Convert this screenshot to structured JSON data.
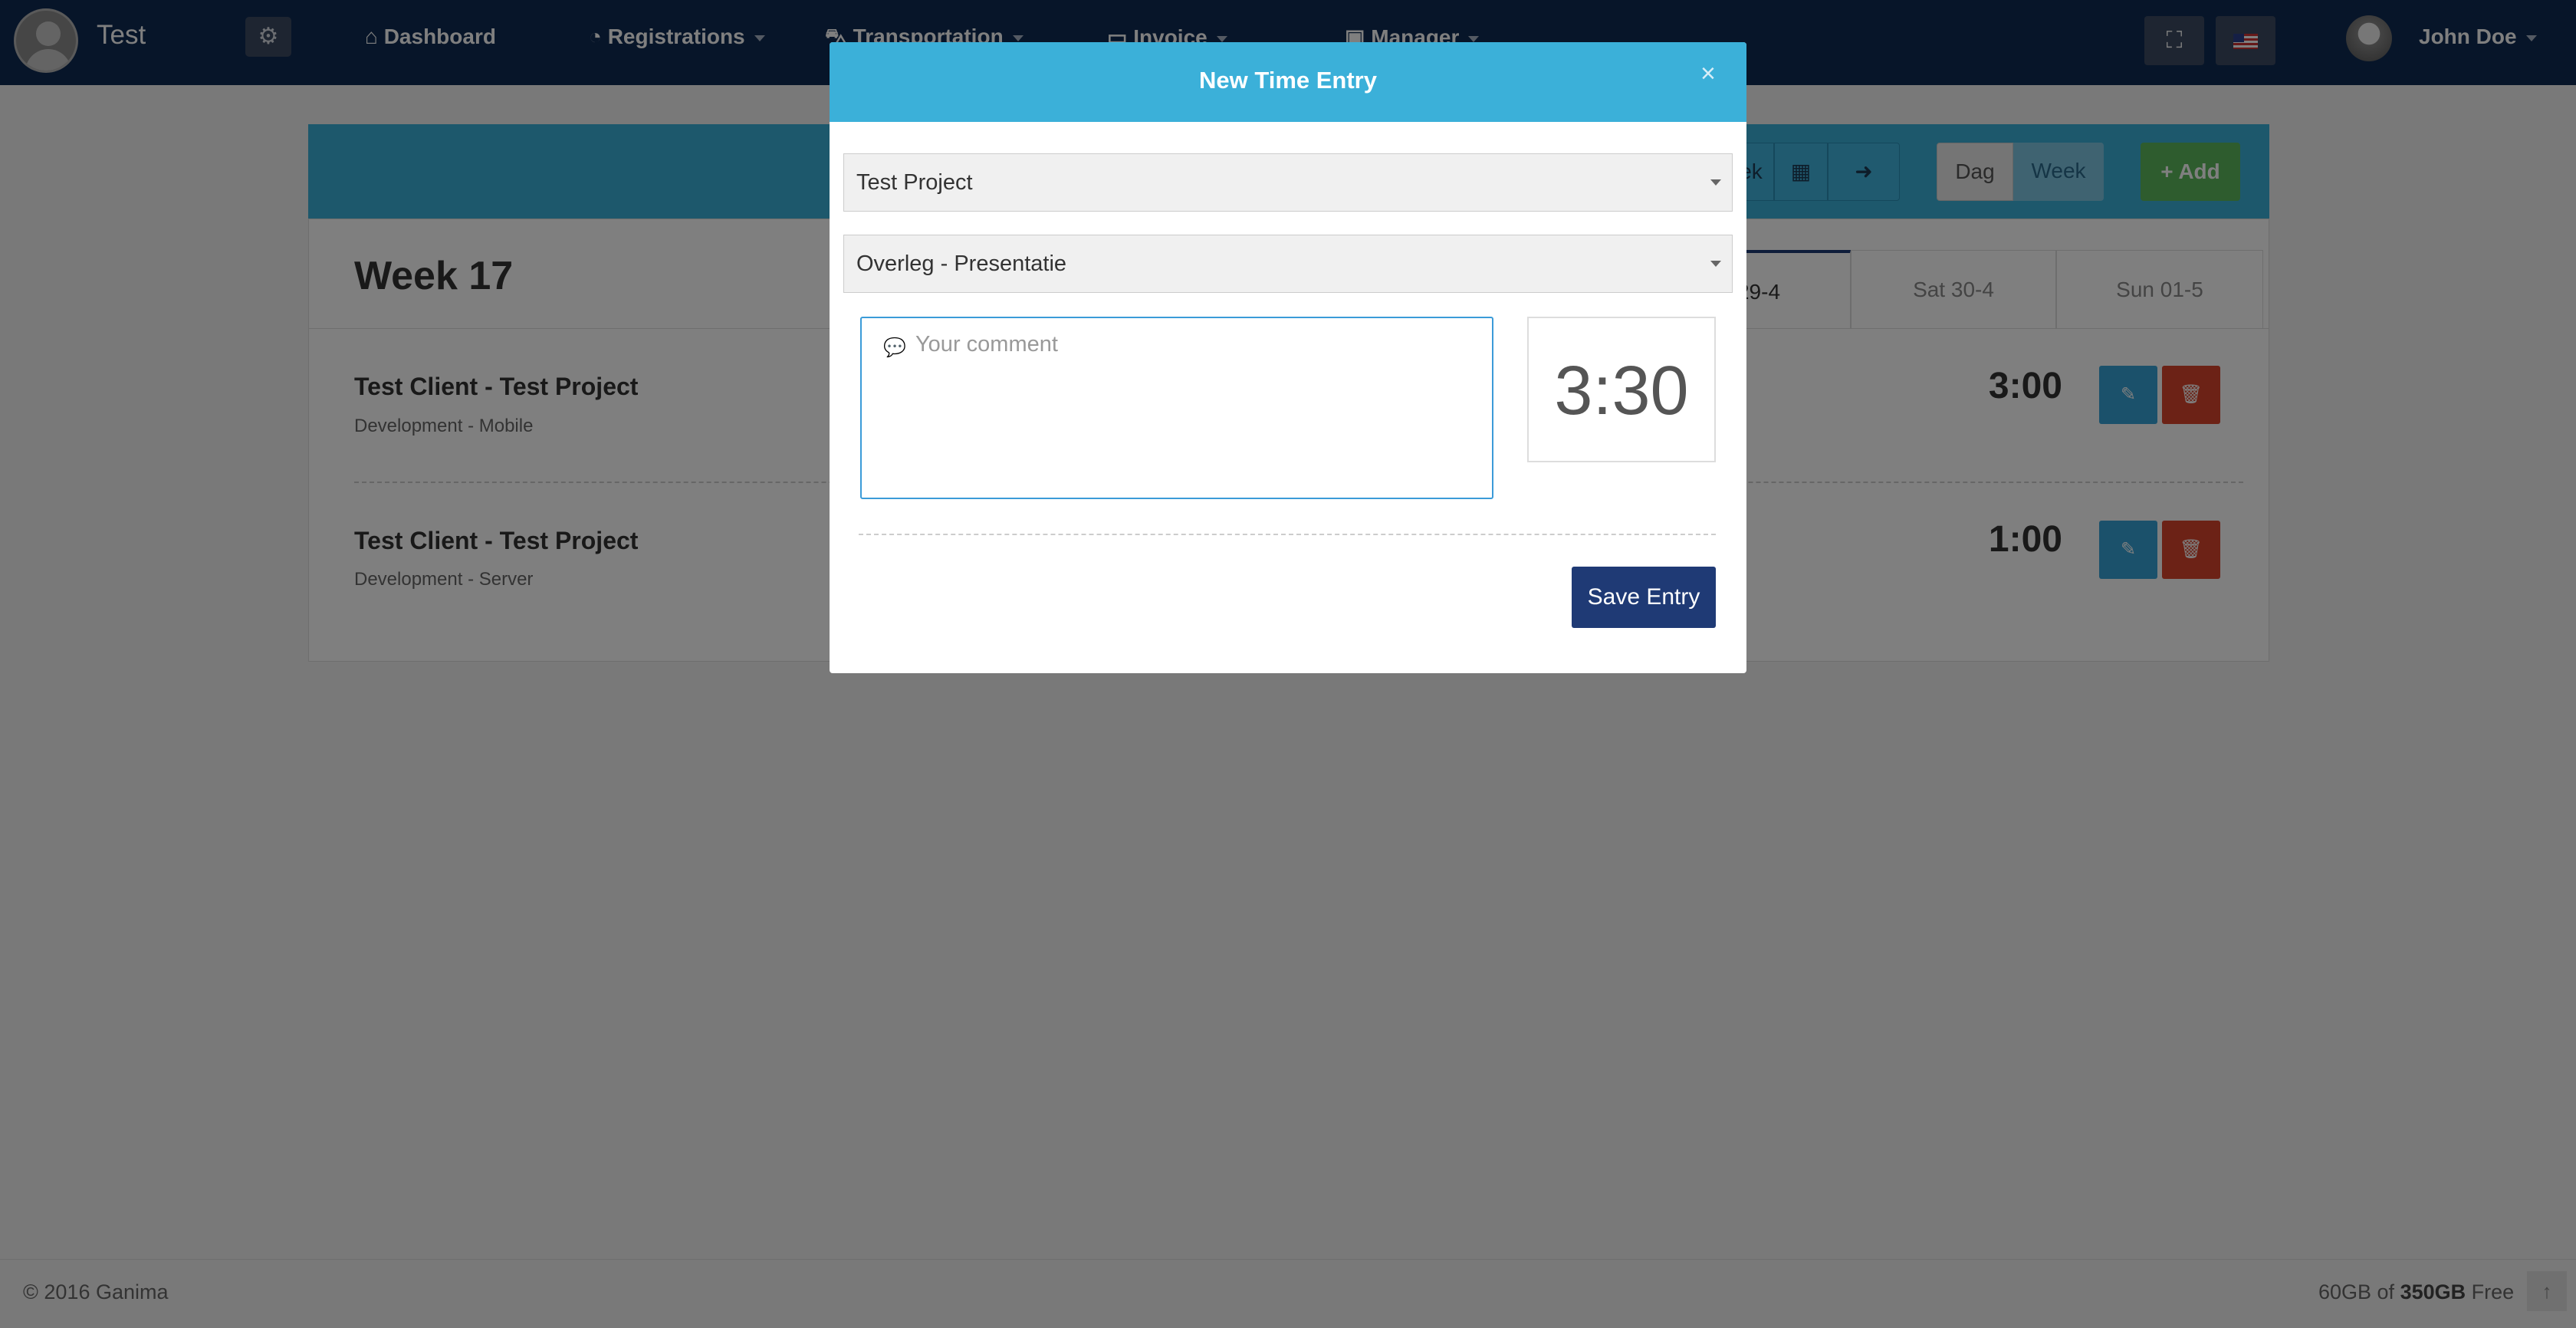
{
  "app": {
    "name": "Test"
  },
  "nav": {
    "items": [
      {
        "icon": "home-icon",
        "label": "Dashboard"
      },
      {
        "icon": "dashboard-icon",
        "label": "Registrations"
      },
      {
        "icon": "car-icon",
        "label": "Transportation"
      },
      {
        "icon": "credit-card-icon",
        "label": "Invoice"
      },
      {
        "icon": "briefcase-icon",
        "label": "Manager"
      }
    ]
  },
  "user": {
    "name": "John Doe"
  },
  "page": {
    "toolbar": {
      "week_partial": "ek",
      "dag": "Dag",
      "week": "Week",
      "add": "Add"
    },
    "week_title": "Week 17",
    "days": [
      {
        "label": "29-4"
      },
      {
        "label": "Sat 30-4"
      },
      {
        "label": "Sun 01-5"
      }
    ],
    "entries": [
      {
        "title": "Test Client - Test Project",
        "subtitle": "Development - Mobile",
        "hours": "3:00"
      },
      {
        "title": "Test Client - Test Project",
        "subtitle": "Development - Server",
        "hours": "1:00"
      }
    ]
  },
  "footer": {
    "copyright": "© 2016 Ganima",
    "storage_used": "60GB of ",
    "storage_total": "350GB",
    "storage_suffix": " Free"
  },
  "modal": {
    "title": "New Time Entry",
    "close": "×",
    "project_select": "Test Project",
    "task_select": "Overleg - Presentatie",
    "comment_placeholder": "Your comment",
    "comment_value": "",
    "time": "3:30",
    "save": "Save Entry"
  },
  "colors": {
    "navbar": "#0e2a52",
    "header": "#3bb0d9",
    "primary": "#1f3a75",
    "edit": "#36a3d6",
    "delete": "#d9442c",
    "add": "#5cb85c"
  }
}
